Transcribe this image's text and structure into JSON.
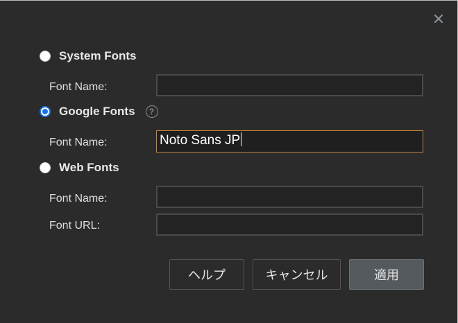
{
  "dialog": {
    "close_glyph": "✕",
    "options": {
      "system": {
        "label": "System Fonts",
        "selected": false
      },
      "google": {
        "label": "Google Fonts",
        "selected": true,
        "help_glyph": "?"
      },
      "web": {
        "label": "Web Fonts",
        "selected": false
      }
    },
    "fields": {
      "system_font_name": {
        "label": "Font Name:",
        "value": ""
      },
      "google_font_name": {
        "label": "Font Name:",
        "value": "Noto Sans JP"
      },
      "web_font_name": {
        "label": "Font Name:",
        "value": ""
      },
      "web_font_url": {
        "label": "Font URL:",
        "value": ""
      }
    },
    "buttons": {
      "help": "ヘルプ",
      "cancel": "キャンセル",
      "apply": "適用"
    }
  },
  "colors": {
    "background": "#2b2b2b",
    "radio_accent": "#1a73e8",
    "focus_border": "#c9863a",
    "primary_button": "#555a5e"
  },
  "icons": {
    "close": "close-icon",
    "help": "help-circle-icon"
  }
}
